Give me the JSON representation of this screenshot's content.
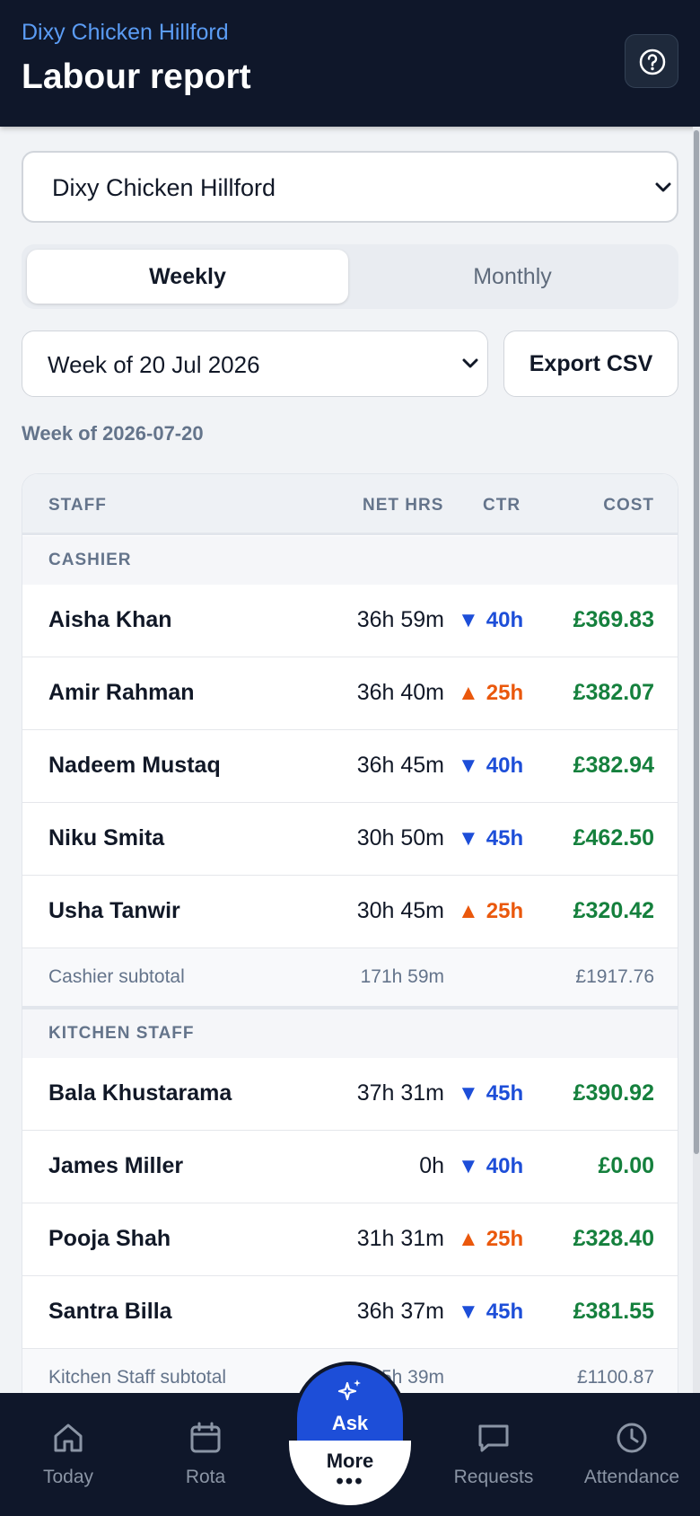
{
  "header": {
    "venue": "Dixy Chicken Hillford",
    "title": "Labour report"
  },
  "venue_select": {
    "value": "Dixy Chicken Hillford"
  },
  "period_tabs": {
    "weekly": "Weekly",
    "monthly": "Monthly"
  },
  "week_select": {
    "value": "Week of 20 Jul 2026"
  },
  "export_label": "Export CSV",
  "week_label": "Week of 2026-07-20",
  "table": {
    "headers": {
      "staff": "STAFF",
      "net_hrs": "NET HRS",
      "ctr": "CTR",
      "cost": "COST"
    },
    "groups": [
      {
        "name": "CASHIER",
        "rows": [
          {
            "name": "Aisha Khan",
            "hrs": "36h 59m",
            "ctr": "40h",
            "ctr_dir": "down",
            "cost": "£369.83"
          },
          {
            "name": "Amir Rahman",
            "hrs": "36h 40m",
            "ctr": "25h",
            "ctr_dir": "up",
            "cost": "£382.07"
          },
          {
            "name": "Nadeem Mustaq",
            "hrs": "36h 45m",
            "ctr": "40h",
            "ctr_dir": "down",
            "cost": "£382.94"
          },
          {
            "name": "Niku Smita",
            "hrs": "30h 50m",
            "ctr": "45h",
            "ctr_dir": "down",
            "cost": "£462.50"
          },
          {
            "name": "Usha Tanwir",
            "hrs": "30h 45m",
            "ctr": "25h",
            "ctr_dir": "up",
            "cost": "£320.42"
          }
        ],
        "subtotal": {
          "label": "Cashier subtotal",
          "hrs": "171h 59m",
          "cost": "£1917.76"
        }
      },
      {
        "name": "KITCHEN STAFF",
        "rows": [
          {
            "name": "Bala Khustarama",
            "hrs": "37h 31m",
            "ctr": "45h",
            "ctr_dir": "down",
            "cost": "£390.92"
          },
          {
            "name": "James Miller",
            "hrs": "0h",
            "ctr": "40h",
            "ctr_dir": "down",
            "cost": "£0.00"
          },
          {
            "name": "Pooja Shah",
            "hrs": "31h 31m",
            "ctr": "25h",
            "ctr_dir": "up",
            "cost": "£328.40"
          },
          {
            "name": "Santra Billa",
            "hrs": "36h 37m",
            "ctr": "45h",
            "ctr_dir": "down",
            "cost": "£381.55"
          }
        ],
        "subtotal": {
          "label": "Kitchen Staff subtotal",
          "hrs": "…5h 39m",
          "cost": "£1100.87"
        }
      }
    ]
  },
  "nav": {
    "today": "Today",
    "rota": "Rota",
    "ask": "Ask",
    "more": "More",
    "requests": "Requests",
    "attendance": "Attendance"
  },
  "icons": {
    "help": "help-icon",
    "chevron": "chevron-down-icon",
    "today": "home-icon",
    "rota": "calendar-icon",
    "ask": "sparkle-icon",
    "more": "more-dots-icon",
    "requests": "chat-icon",
    "attendance": "clock-icon"
  },
  "colors": {
    "header_bg": "#0f172a",
    "venue_link": "#5b9cf4",
    "cost_green": "#15803d",
    "ctr_down": "#1d4ed8",
    "ctr_up": "#ea580c",
    "ask_blue": "#1d4ed8"
  }
}
